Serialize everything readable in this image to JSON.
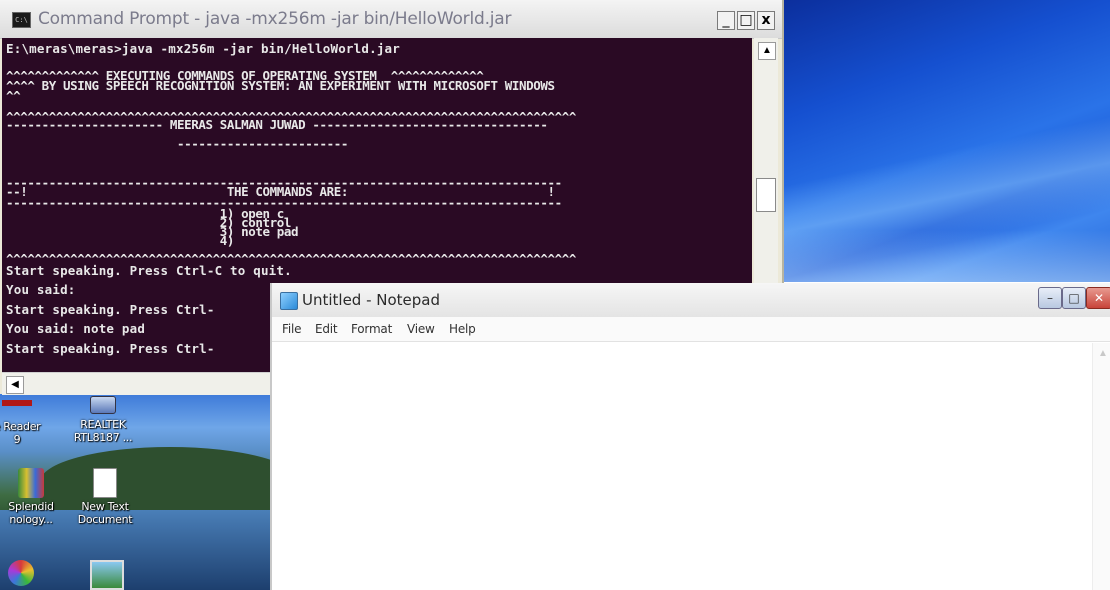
{
  "cmd": {
    "title": "Command Prompt - java -mx256m -jar bin/HelloWorld.jar",
    "icon": "cmd-icon",
    "buttons": {
      "minimize": "_",
      "maximize": "□",
      "close": "x"
    },
    "console_lines": [
      "E:\\meras\\meras>java -mx256m -jar bin/HelloWorld.jar",
      "^^^^^^^^^^^^^ EXECUTING COMMANDS OF OPERATING SYSTEM  ^^^^^^^^^^^^^",
      "^^^^ BY USING SPEECH RECOGNITION SYSTEM: AN EXPERIMENT WITH MICROSOFT WINDOWS",
      "^^",
      "^^^^^^^^^^^^^^^^^^^^^^^^^^^^^^^^^^^^^^^^^^^^^^^^^^^^^^^^^^^^^^^^^^^^^^^^^^^^^^^^",
      "---------------------- MEERAS SALMAN JUWAD ---------------------------------",
      "                        ------------------------",
      "------------------------------------------------------------------------------",
      "--!                            THE COMMANDS ARE:                            !",
      "------------------------------------------------------------------------------",
      "                              1) open c",
      "                              2) control",
      "                              3) note pad",
      "                              4)",
      "^^^^^^^^^^^^^^^^^^^^^^^^^^^^^^^^^^^^^^^^^^^^^^^^^^^^^^^^^^^^^^^^^^^^^^^^^^^^^^^^",
      "Start speaking. Press Ctrl-C to quit.",
      "You said:",
      "Start speaking. Press Ctrl-",
      "You said: note pad",
      "Start speaking. Press Ctrl-"
    ]
  },
  "notepad": {
    "title": "Untitled - Notepad",
    "icon": "notepad-icon",
    "menu": [
      "File",
      "Edit",
      "Format",
      "View",
      "Help"
    ],
    "content": ""
  },
  "desktop_icons": [
    {
      "line1": "e Reader",
      "line2": "9",
      "icon": "adobe-reader-icon"
    },
    {
      "line1": "REALTEK",
      "line2": "RTL8187 ...",
      "icon": "realtek-shortcut-icon"
    },
    {
      "line1": "Splendid",
      "line2": "nology...",
      "icon": "splendid-icon"
    },
    {
      "line1": "New Text",
      "line2": "Document",
      "icon": "text-document-icon"
    }
  ],
  "colors": {
    "console_bg": "#2a0a24",
    "console_text": "#e8e8e8",
    "close_button": "#c8443a"
  }
}
